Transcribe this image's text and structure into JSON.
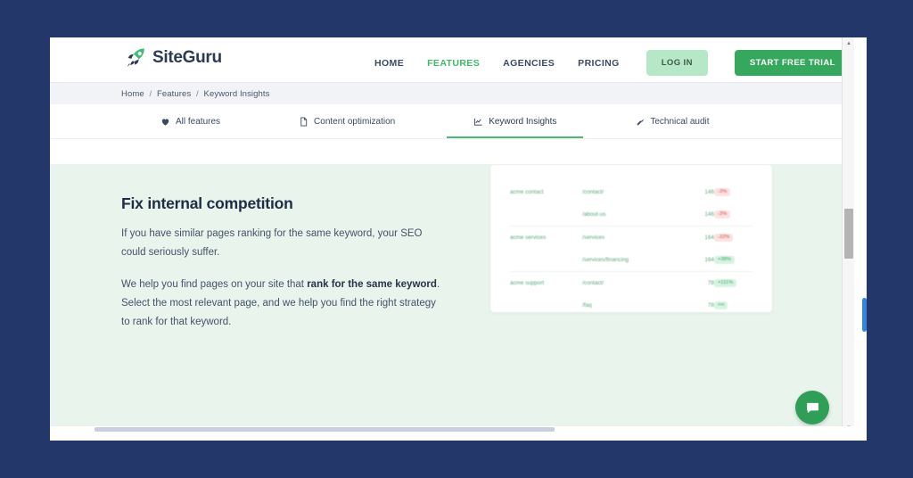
{
  "header": {
    "logo_text": "SiteGuru",
    "logo_icon": "rocket-icon",
    "nav": [
      {
        "label": "HOME",
        "active": false
      },
      {
        "label": "FEATURES",
        "active": true
      },
      {
        "label": "AGENCIES",
        "active": false
      },
      {
        "label": "PRICING",
        "active": false
      }
    ],
    "login_label": "LOG IN",
    "trial_label": "START FREE TRIAL"
  },
  "breadcrumb": {
    "items": [
      "Home",
      "Features",
      "Keyword Insights"
    ],
    "separator": "/"
  },
  "tabs": [
    {
      "label": "All features",
      "icon": "heart-icon",
      "active": false
    },
    {
      "label": "Content optimization",
      "icon": "document-icon",
      "active": false
    },
    {
      "label": "Keyword Insights",
      "icon": "chart-line-icon",
      "active": true
    },
    {
      "label": "Technical audit",
      "icon": "wrench-icon",
      "active": false
    }
  ],
  "hero": {
    "title": "Fix internal competition",
    "paragraph1": "If you have similar pages ranking for the same keyword, your SEO could seriously suffer.",
    "paragraph2_before": "We help you find pages on your site that ",
    "paragraph2_bold": "rank for the same keyword",
    "paragraph2_after": ". Select the most relevant page, and we help you find the right strategy to rank for that keyword."
  },
  "keyword_table": {
    "rows": [
      {
        "keyword": "acme contact",
        "url": "/contact/",
        "volume": "146",
        "delta": "-3%",
        "trend": "neg",
        "group_start": true
      },
      {
        "keyword": "",
        "url": "/about-us",
        "volume": "146",
        "delta": "-3%",
        "trend": "neg",
        "group_start": false
      },
      {
        "keyword": "acme services",
        "url": "/services",
        "volume": "164",
        "delta": "-32%",
        "trend": "neg",
        "group_start": true
      },
      {
        "keyword": "",
        "url": "/services/financing",
        "volume": "164",
        "delta": "+38%",
        "trend": "pos",
        "group_start": false
      },
      {
        "keyword": "acme support",
        "url": "/contact/",
        "volume": "78",
        "delta": "+111%",
        "trend": "pos",
        "group_start": true
      },
      {
        "keyword": "",
        "url": "/faq",
        "volume": "78",
        "delta": "+∞",
        "trend": "pos",
        "group_start": false
      }
    ]
  },
  "chat": {
    "icon": "speech-bubble-icon"
  },
  "scrollbar": {
    "up_arrow": "▲",
    "down_arrow": "▼"
  },
  "colors": {
    "page_background": "#23376b",
    "brand_green": "#35a85d",
    "accent_light_green": "#b6e8c8",
    "content_background": "#e9f4ed",
    "heading": "#1f2d44",
    "positive": "#37a862",
    "negative": "#d9534f"
  }
}
